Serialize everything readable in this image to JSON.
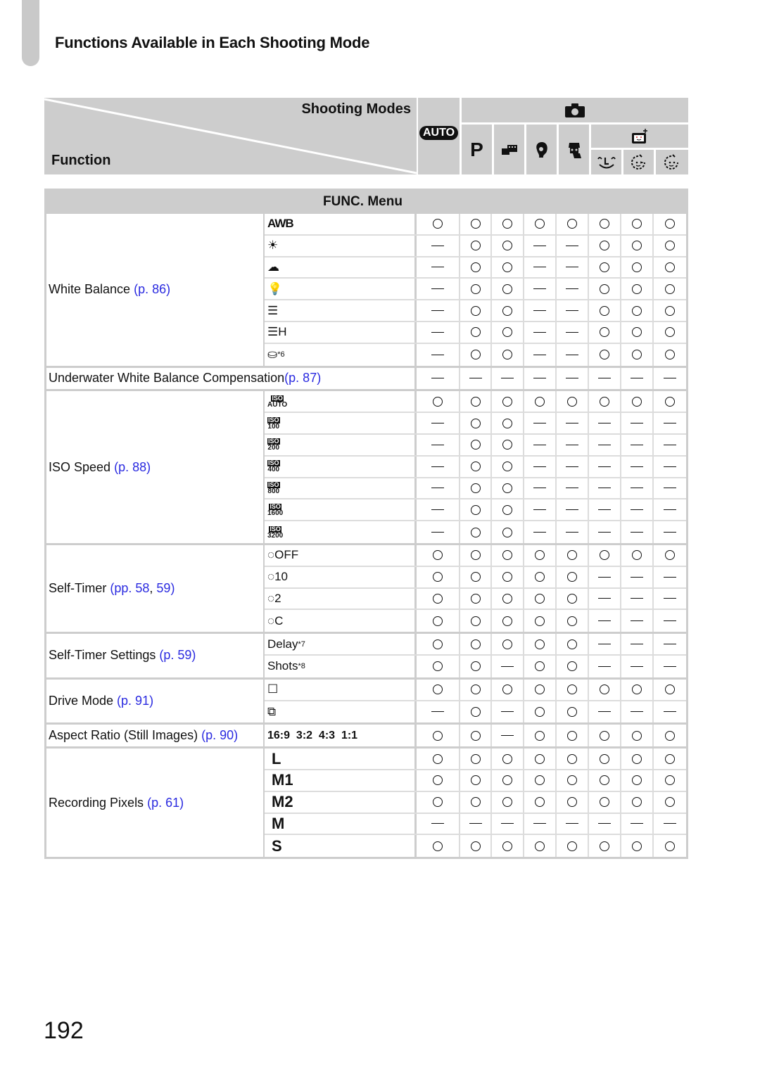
{
  "page": {
    "heading": "Functions Available in Each Shooting Mode",
    "number": "192"
  },
  "header": {
    "shooting_modes_label": "Shooting Modes",
    "function_label": "Function",
    "modes": [
      {
        "id": "auto",
        "icon": "auto-mode-icon",
        "glyph": "AUTO"
      },
      {
        "id": "camera-group",
        "icon": "camera-icon",
        "glyph": "📷"
      },
      {
        "id": "p",
        "icon": "program-mode-icon",
        "glyph": "P"
      },
      {
        "id": "live-view",
        "icon": "live-view-control-icon",
        "glyph": "▪"
      },
      {
        "id": "portrait",
        "icon": "portrait-icon",
        "glyph": "☺"
      },
      {
        "id": "kids-pets",
        "icon": "kids-pets-icon",
        "glyph": "☻"
      },
      {
        "id": "smart-shutter",
        "icon": "smart-shutter-icon",
        "glyph": "▣"
      },
      {
        "id": "smile",
        "icon": "smile-icon",
        "glyph": "ᵔLᵔ"
      },
      {
        "id": "wink-timer",
        "icon": "wink-self-timer-icon",
        "glyph": "◔"
      },
      {
        "id": "face-timer",
        "icon": "face-self-timer-icon",
        "glyph": "◕"
      }
    ]
  },
  "section_title": "FUNC. Menu",
  "symbols": {
    "yes": "○",
    "no": "—"
  },
  "groups": [
    {
      "label": "White Balance",
      "ref": "(p. 86)",
      "rows": [
        {
          "sub": "AWB",
          "icon": "auto-white-balance-icon",
          "values": [
            "yes",
            "yes",
            "yes",
            "yes",
            "yes",
            "yes",
            "yes",
            "yes"
          ]
        },
        {
          "sub": "☀",
          "icon": "daylight-icon",
          "values": [
            "no",
            "yes",
            "yes",
            "no",
            "no",
            "yes",
            "yes",
            "yes"
          ]
        },
        {
          "sub": "☁",
          "icon": "cloudy-icon",
          "values": [
            "no",
            "yes",
            "yes",
            "no",
            "no",
            "yes",
            "yes",
            "yes"
          ]
        },
        {
          "sub": "💡",
          "icon": "tungsten-icon",
          "values": [
            "no",
            "yes",
            "yes",
            "no",
            "no",
            "yes",
            "yes",
            "yes"
          ]
        },
        {
          "sub": "☰",
          "icon": "fluorescent-icon",
          "values": [
            "no",
            "yes",
            "yes",
            "no",
            "no",
            "yes",
            "yes",
            "yes"
          ]
        },
        {
          "sub": "☰H",
          "icon": "fluorescent-h-icon",
          "values": [
            "no",
            "yes",
            "yes",
            "no",
            "no",
            "yes",
            "yes",
            "yes"
          ]
        },
        {
          "sub": "⛀",
          "icon": "custom-white-balance-icon",
          "note": "*6",
          "values": [
            "no",
            "yes",
            "yes",
            "no",
            "no",
            "yes",
            "yes",
            "yes"
          ]
        }
      ]
    },
    {
      "label": "Underwater White Balance Compensation",
      "ref": "(p. 87)",
      "full": true,
      "rows": [
        {
          "values": [
            "no",
            "no",
            "no",
            "no",
            "no",
            "no",
            "no",
            "no"
          ]
        }
      ]
    },
    {
      "label": "ISO Speed",
      "ref": "(p. 88)",
      "rows": [
        {
          "sub": "AUTO",
          "icon": "iso-auto-icon",
          "values": [
            "yes",
            "yes",
            "yes",
            "yes",
            "yes",
            "yes",
            "yes",
            "yes"
          ]
        },
        {
          "sub": "100",
          "icon": "iso-100-icon",
          "values": [
            "no",
            "yes",
            "yes",
            "no",
            "no",
            "no",
            "no",
            "no"
          ]
        },
        {
          "sub": "200",
          "icon": "iso-200-icon",
          "values": [
            "no",
            "yes",
            "yes",
            "no",
            "no",
            "no",
            "no",
            "no"
          ]
        },
        {
          "sub": "400",
          "icon": "iso-400-icon",
          "values": [
            "no",
            "yes",
            "yes",
            "no",
            "no",
            "no",
            "no",
            "no"
          ]
        },
        {
          "sub": "800",
          "icon": "iso-800-icon",
          "values": [
            "no",
            "yes",
            "yes",
            "no",
            "no",
            "no",
            "no",
            "no"
          ]
        },
        {
          "sub": "1600",
          "icon": "iso-1600-icon",
          "values": [
            "no",
            "yes",
            "yes",
            "no",
            "no",
            "no",
            "no",
            "no"
          ]
        },
        {
          "sub": "3200",
          "icon": "iso-3200-icon",
          "values": [
            "no",
            "yes",
            "yes",
            "no",
            "no",
            "no",
            "no",
            "no"
          ]
        }
      ]
    },
    {
      "label": "Self-Timer",
      "ref_prefix": "(pp. 58",
      "ref_sep": ", ",
      "ref_suffix": "59)",
      "rows": [
        {
          "sub": "◌OFF",
          "icon": "self-timer-off-icon",
          "values": [
            "yes",
            "yes",
            "yes",
            "yes",
            "yes",
            "yes",
            "yes",
            "yes"
          ]
        },
        {
          "sub": "◌10",
          "icon": "self-timer-10s-icon",
          "values": [
            "yes",
            "yes",
            "yes",
            "yes",
            "yes",
            "no",
            "no",
            "no"
          ]
        },
        {
          "sub": "◌2",
          "icon": "self-timer-2s-icon",
          "values": [
            "yes",
            "yes",
            "yes",
            "yes",
            "yes",
            "no",
            "no",
            "no"
          ]
        },
        {
          "sub": "◌C",
          "icon": "self-timer-custom-icon",
          "values": [
            "yes",
            "yes",
            "yes",
            "yes",
            "yes",
            "no",
            "no",
            "no"
          ]
        }
      ]
    },
    {
      "label": "Self-Timer Settings",
      "ref": "(p. 59)",
      "rows": [
        {
          "sub": "Delay",
          "note": "*7",
          "values": [
            "yes",
            "yes",
            "yes",
            "yes",
            "yes",
            "no",
            "no",
            "no"
          ]
        },
        {
          "sub": "Shots",
          "note": "*8",
          "values": [
            "yes",
            "yes",
            "no",
            "yes",
            "yes",
            "no",
            "no",
            "no"
          ]
        }
      ]
    },
    {
      "label": "Drive Mode",
      "ref": "(p. 91)",
      "rows": [
        {
          "sub": "☐",
          "icon": "single-shot-icon",
          "values": [
            "yes",
            "yes",
            "yes",
            "yes",
            "yes",
            "yes",
            "yes",
            "yes"
          ]
        },
        {
          "sub": "⧉",
          "icon": "continuous-shot-icon",
          "values": [
            "no",
            "yes",
            "no",
            "yes",
            "yes",
            "no",
            "no",
            "no"
          ]
        }
      ]
    },
    {
      "label": "Aspect Ratio (Still Images)",
      "ref": "(p. 90)",
      "rows": [
        {
          "sub": "16:9  3:2  4:3  1:1",
          "values": [
            "yes",
            "yes",
            "no",
            "yes",
            "yes",
            "yes",
            "yes",
            "yes"
          ]
        }
      ]
    },
    {
      "label": "Recording Pixels",
      "ref": "(p. 61)",
      "rows": [
        {
          "sub": "L",
          "values": [
            "yes",
            "yes",
            "yes",
            "yes",
            "yes",
            "yes",
            "yes",
            "yes"
          ]
        },
        {
          "sub": "M1",
          "values": [
            "yes",
            "yes",
            "yes",
            "yes",
            "yes",
            "yes",
            "yes",
            "yes"
          ]
        },
        {
          "sub": "M2",
          "values": [
            "yes",
            "yes",
            "yes",
            "yes",
            "yes",
            "yes",
            "yes",
            "yes"
          ]
        },
        {
          "sub": "M",
          "values": [
            "no",
            "no",
            "no",
            "no",
            "no",
            "no",
            "no",
            "no"
          ]
        },
        {
          "sub": "S",
          "values": [
            "yes",
            "yes",
            "yes",
            "yes",
            "yes",
            "yes",
            "yes",
            "yes"
          ]
        }
      ]
    }
  ]
}
